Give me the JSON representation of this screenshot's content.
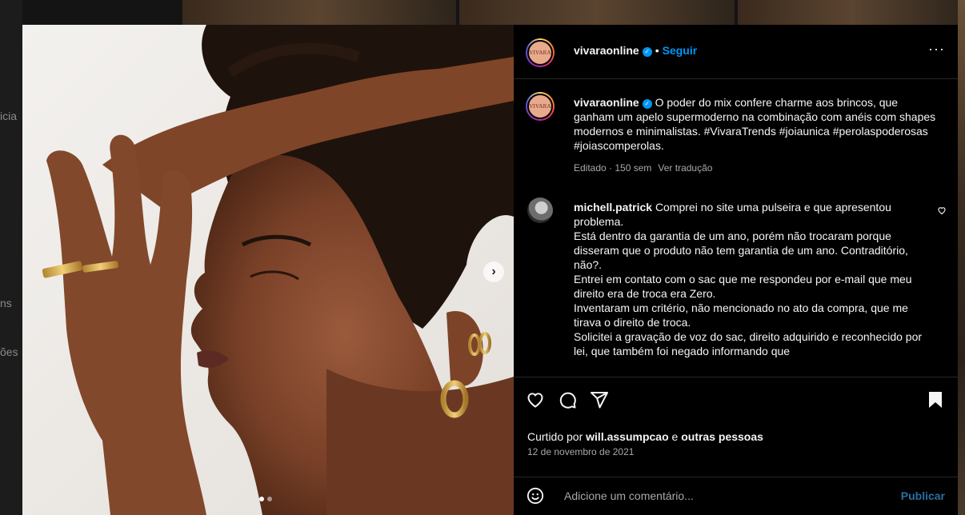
{
  "background": {
    "left_partial_texts": [
      "icia",
      "ns",
      "ões"
    ]
  },
  "post": {
    "author": "vivaraonline",
    "avatar_text": "VIVARA",
    "follow_label": "Seguir",
    "more_icon": "more-horizontal-icon",
    "carousel": {
      "current_slide": 1,
      "total_slides": 2
    },
    "caption": "O poder do mix confere charme aos brincos, que ganham um apelo supermoderno na combinação com anéis com shapes modernos e minimalistas. #VivaraTrends #joiaunica #perolaspoderosas #joiascomperolas.",
    "caption_meta": "Editado · 150 sem",
    "translate_label": "Ver tradução",
    "comments": [
      {
        "user": "michell.patrick",
        "lines": [
          "Comprei no site uma pulseira e que apresentou problema.",
          "Está dentro da garantia de um ano, porém não trocaram porque disseram que o produto não tem garantia de um ano. Contraditório, não?.",
          "Entrei em contato com o sac que me respondeu por e-mail que meu direito era de troca era Zero.",
          "Inventaram um critério, não mencionado no ato da compra, que me tirava o direito de troca.",
          "Solicitei a gravação de voz do sac, direito adquirido e reconhecido por lei, que também foi negado informando que"
        ]
      }
    ],
    "liked_prefix": "Curtido por",
    "liked_user": "will.assumpcao",
    "liked_and": "e",
    "liked_others": "outras pessoas",
    "date": "12 de novembro de 2021",
    "comment_placeholder": "Adicione um comentário...",
    "publish_label": "Publicar"
  },
  "colors": {
    "accent": "#0095f6",
    "modal_bg": "#000000",
    "border": "#262626",
    "muted_text": "#a8a8a8"
  }
}
